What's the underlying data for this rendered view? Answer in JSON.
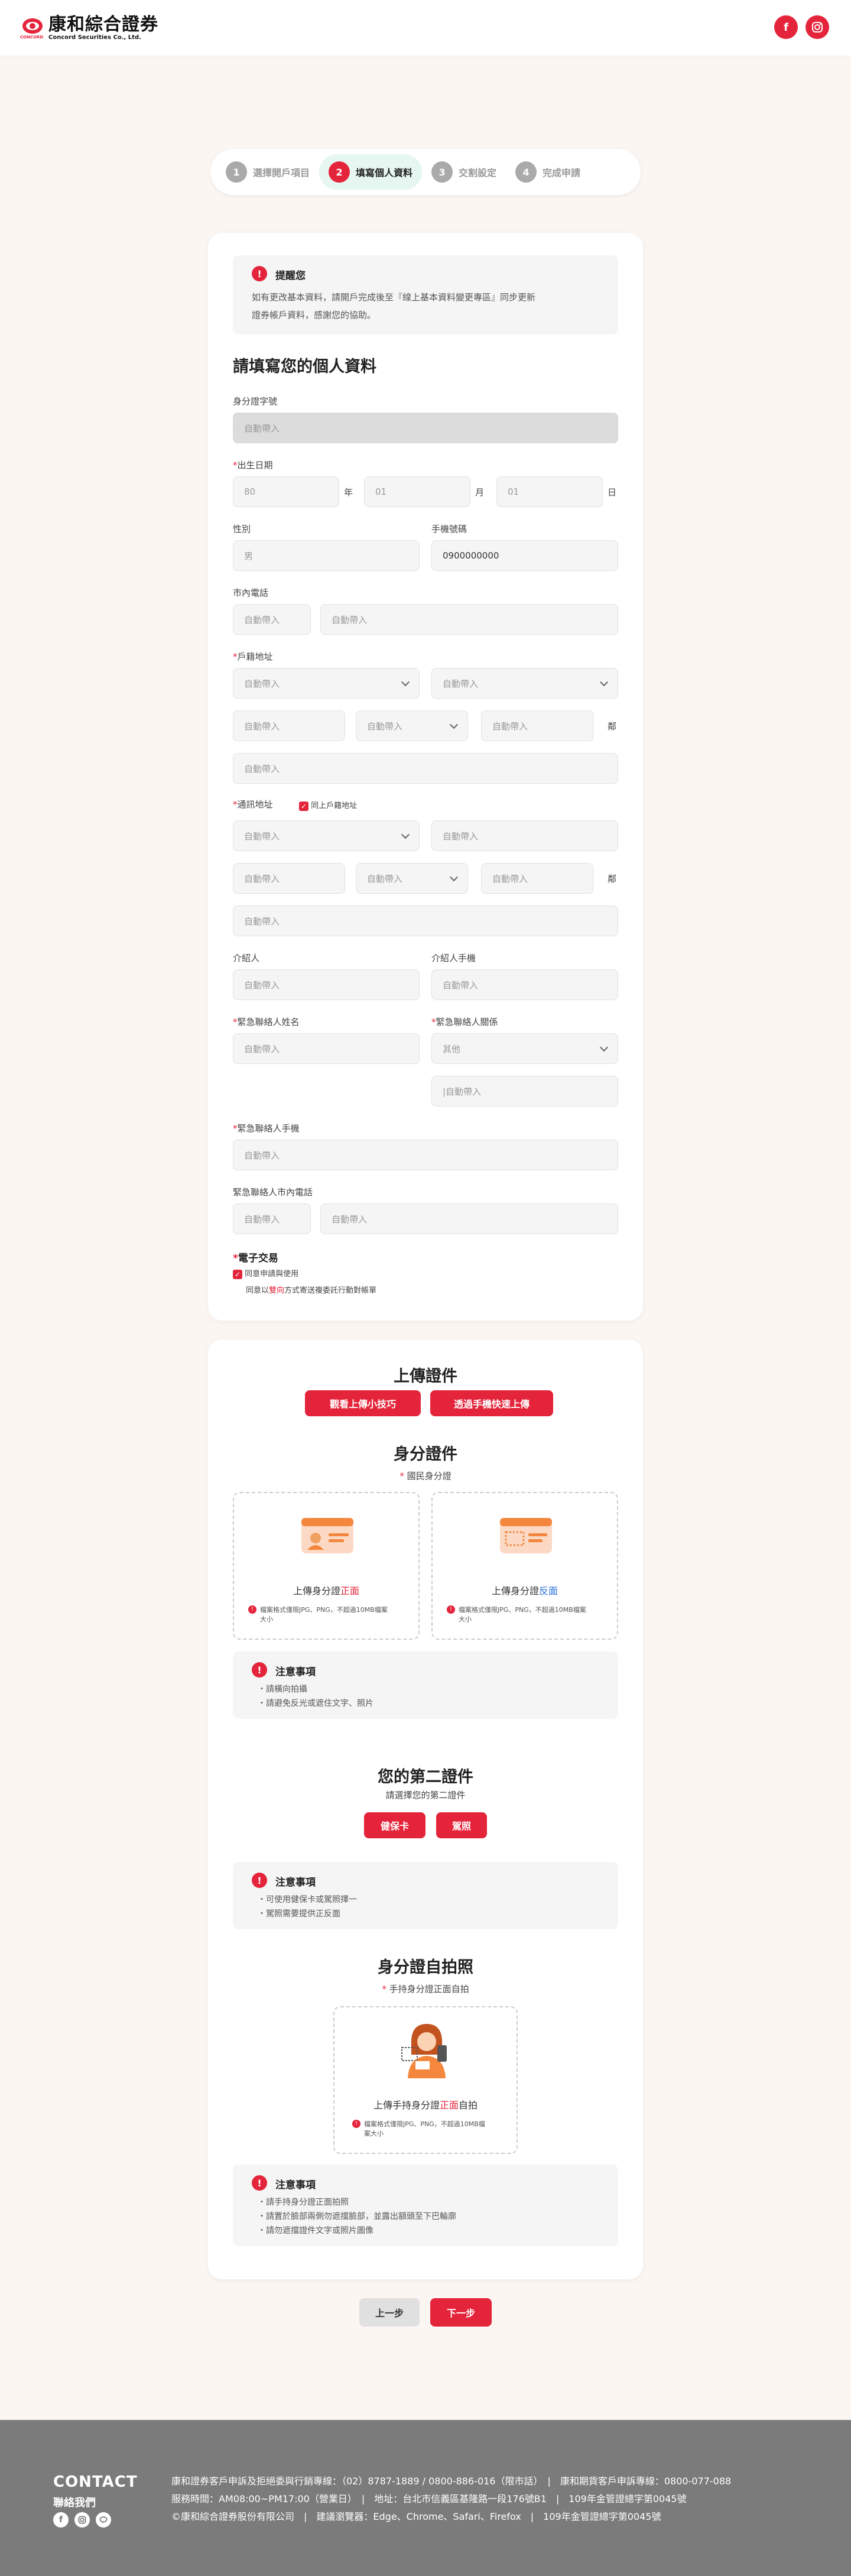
{
  "header": {
    "logo_cn": "康和綜合證券",
    "logo_en": "Concord Securities Co., Ltd.",
    "logo_sub": "CONCORD"
  },
  "steps": [
    {
      "num": "1",
      "label": "選擇開戶項目"
    },
    {
      "num": "2",
      "label": "填寫個人資料"
    },
    {
      "num": "3",
      "label": "交割設定"
    },
    {
      "num": "4",
      "label": "完成申請"
    }
  ],
  "reminder": {
    "title": "提醒您",
    "line1": "如有更改基本資料，請開戶完成後至『線上基本資料變更專區』同步更新",
    "line2": "證券帳戶資料，感謝您的協助。"
  },
  "form": {
    "title": "請填寫您的個人資料",
    "auto": "自動帶入",
    "id_label": "身分證字號",
    "birth_label": "出生日期",
    "birth_y": "80",
    "birth_m": "01",
    "birth_d": "01",
    "unit_y": "年",
    "unit_m": "月",
    "unit_d": "日",
    "gender_label": "性別",
    "gender": "男",
    "mobile_label": "手機號碼",
    "mobile": "0900000000",
    "phone_label": "市內電話",
    "reg_label": "戶籍地址",
    "zip_unit": "鄰",
    "mail_label": "通訊地址",
    "same_label": "同上戶籍地址",
    "ref_label": "介紹人",
    "ref_mobile_label": "介紹人手機",
    "ec_name_label": "緊急聯絡人姓名",
    "ec_rel_label": "緊急聯絡人關係",
    "ec_rel": "其他",
    "ec_rel_other": "|自動帶入",
    "ec_mobile_label": "緊急聯絡人手機",
    "ec_phone_label": "緊急聯絡人市內電話",
    "etrade_label": "電子交易",
    "etrade_opt": "同意申請與使用",
    "consent_pre": "同意以",
    "consent_hl": "雙向",
    "consent_post": "方式寄送複委託行動對帳單"
  },
  "upload": {
    "title": "上傳證件",
    "tips_btn": "觀看上傳小技巧",
    "mobile_btn": "透過手機快速上傳",
    "id_title": "身分證件",
    "id_sub": "國民身分證",
    "front_pre": "上傳身分證",
    "front_hl": "正面",
    "front_post": "",
    "back_pre": "上傳身分證",
    "back_hl": "反面",
    "back_post": "",
    "file_hint1": "檔案格式僅限JPG、PNG，不超過10MB檔案",
    "file_hint2": "大小",
    "n1_title": "注意事項",
    "n1_items": [
      "請橫向拍攝",
      "請避免反光或遮住文字、照片"
    ],
    "second_title": "您的第二證件",
    "second_sub": "請選擇您的第二證件",
    "health_btn": "健保卡",
    "passport_btn": "駕照",
    "n2_title": "注意事項",
    "n2_items": [
      "可使用健保卡或駕照擇一",
      "駕照需要提供正反面"
    ],
    "selfie_title": "身分證自拍照",
    "selfie_sub": "手持身分證正面自拍",
    "selfie_pre": "上傳手持身分證",
    "selfie_hl": "正面",
    "selfie_post": "自拍",
    "selfie_hint1": "檔案格式僅限JPG、PNG，不超過10MB檔",
    "selfie_hint2": "案大小",
    "n3_title": "注意事項",
    "n3_items": [
      "請手持身分證正面拍照",
      "請置於臉部兩側勿遮擋臉部，並露出額頭至下巴輪廓",
      "請勿遮擋證件文字或照片圖像"
    ]
  },
  "nav": {
    "prev": "上一步",
    "next": "下一步"
  },
  "footer": {
    "contact": "CONTACT",
    "contact_us": "聯絡我們",
    "line1": "康和證券客戶申訴及拒絕委與行銷專線：（02）8787-1889 / 0800-886-016（限市話）　|　康和期貨客戶申訴專線：0800-077-088",
    "line2": "服務時間：AM08:00~PM17:00（營業日）　|　地址：台北市信義區基隆路一段176號B1　|　109年金管證總字第0045號",
    "line3": "©康和綜合證券股份有限公司　|　建議瀏覽器：Edge、Chrome、Safari、Firefox　|　109年金管證總字第0045號"
  },
  "colors": {
    "accent": "#e4243b",
    "footer_bg": "#7b7b7b",
    "step_active_bg": "#e6f6f1",
    "page_bg": "#fcf6f3"
  }
}
